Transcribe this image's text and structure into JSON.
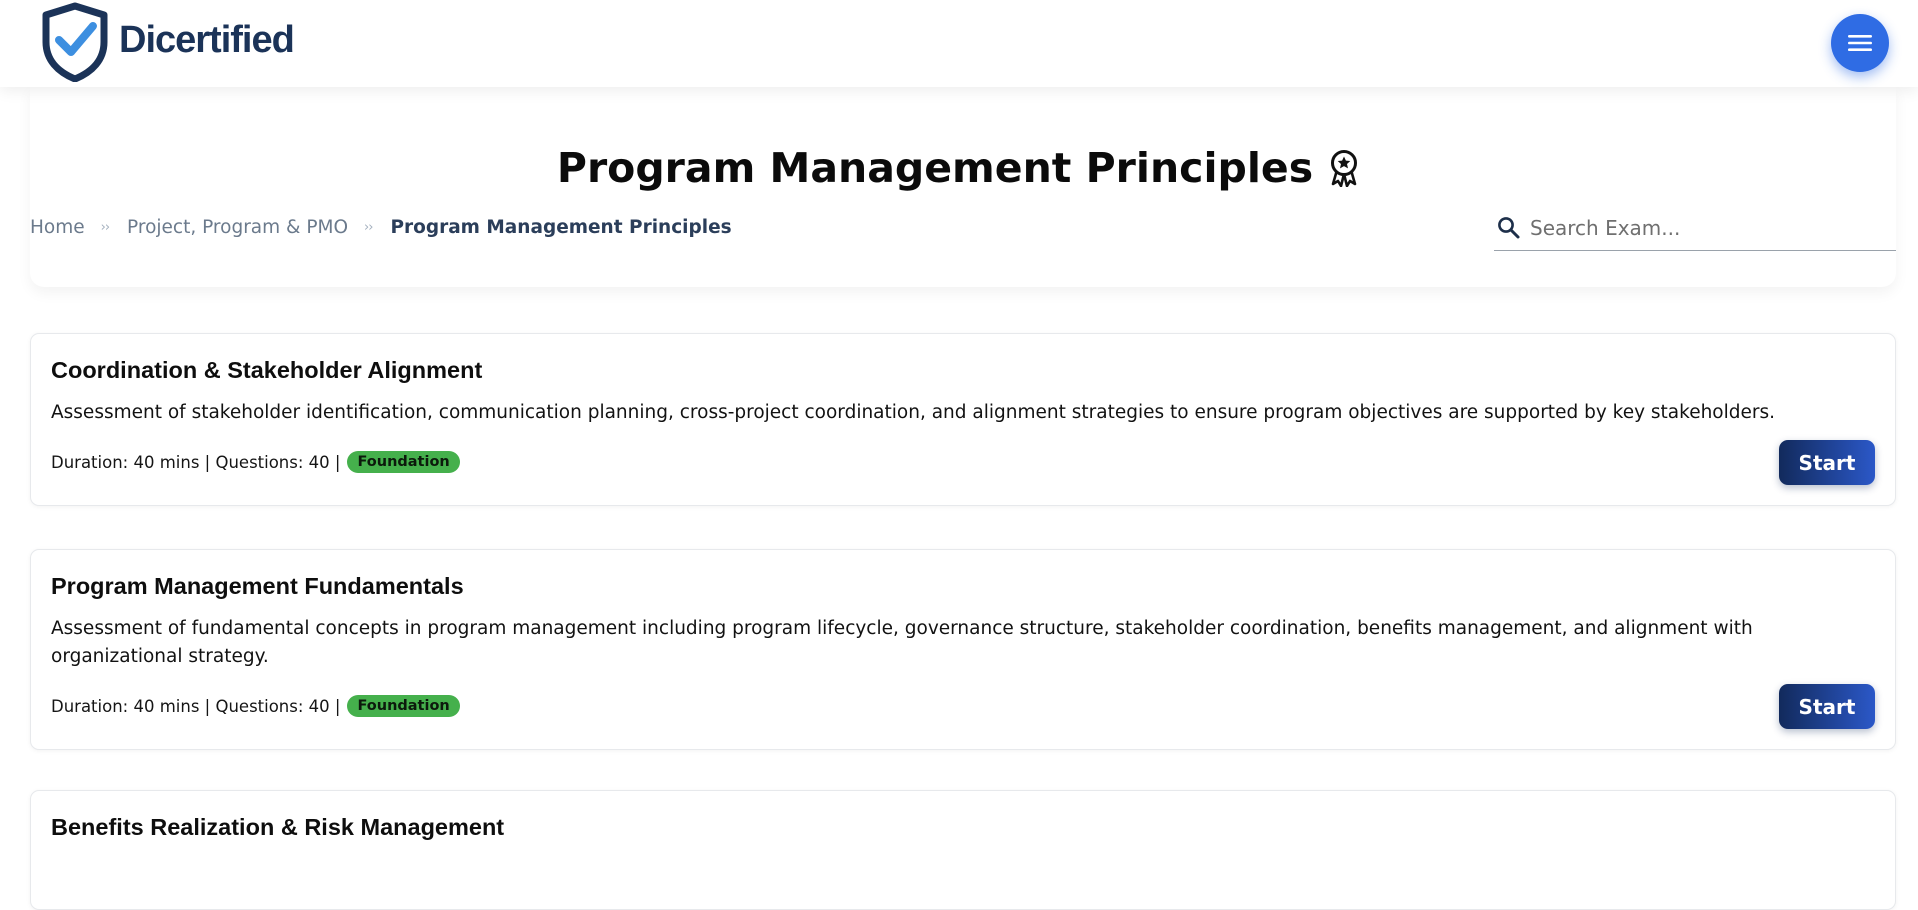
{
  "brand": {
    "name": "Dicertified"
  },
  "header": {
    "menu_icon": "hamburger-menu-icon"
  },
  "page": {
    "title": "Program Management Principles",
    "title_icon": "award-badge-icon"
  },
  "breadcrumb": {
    "separator": "››",
    "items": [
      "Home",
      "Project, Program & PMO",
      "Program Management Principles"
    ]
  },
  "search": {
    "placeholder": "Search Exam...",
    "value": ""
  },
  "labels": {
    "start": "Start"
  },
  "colors": {
    "brand_navy": "#1b3358",
    "accent_blue": "#2f6ce4",
    "level_green": "#45b04c"
  },
  "exams": [
    {
      "title": "Coordination & Stakeholder Alignment",
      "description": "Assessment of stakeholder identification, communication planning, cross-project coordination, and alignment strategies to ensure program objectives are supported by key stakeholders.",
      "meta": "Duration: 40 mins | Questions: 40 |",
      "level": "Foundation"
    },
    {
      "title": "Program Management Fundamentals",
      "description": "Assessment of fundamental concepts in program management including program lifecycle, governance structure, stakeholder coordination, benefits management, and alignment with organizational strategy.",
      "meta": "Duration: 40 mins | Questions: 40 |",
      "level": "Foundation"
    },
    {
      "title": "Benefits Realization & Risk Management"
    }
  ]
}
